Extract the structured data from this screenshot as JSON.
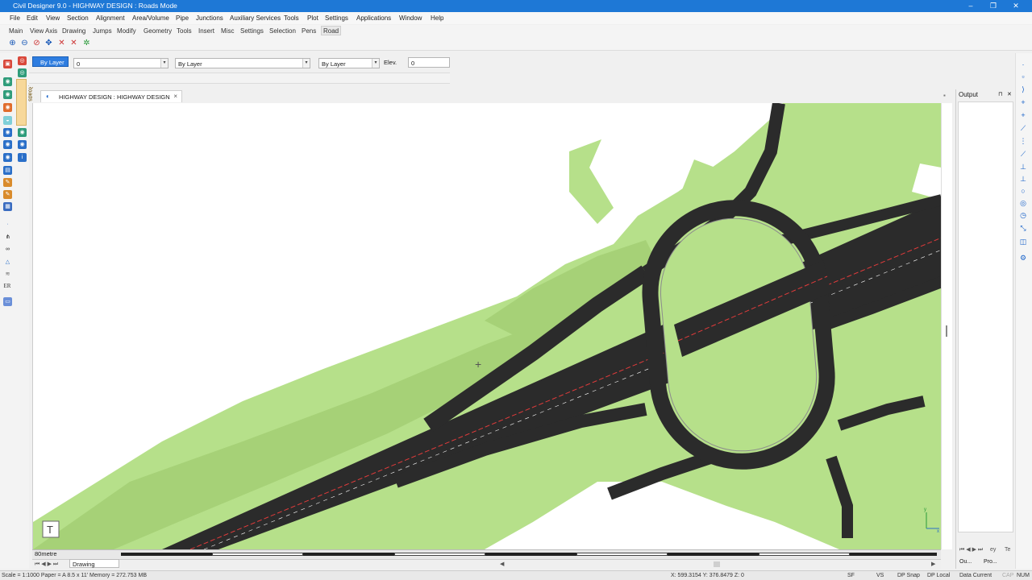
{
  "window": {
    "title": "Civil Designer 9.0 - HIGHWAY DESIGN : Roads Mode",
    "controls": [
      "–",
      "❐",
      "✕"
    ]
  },
  "menu": [
    "File",
    "Edit",
    "View",
    "Section",
    "Alignment",
    "Area/Volume",
    "Pipe",
    "Junctions",
    "Auxiliary Services",
    "Tools",
    "Plot",
    "Settings",
    "Applications",
    "Window",
    "Help"
  ],
  "ribbon_tabs": [
    "Main",
    "View Axis",
    "Drawing",
    "Jumps",
    "Modify",
    "Geometry",
    "Tools",
    "Insert",
    "Misc",
    "Settings",
    "Selection",
    "Pens",
    "Road"
  ],
  "ribbon_active_tab": "Road",
  "properties": {
    "color_button": "By Layer",
    "layer_value": "0",
    "linetype_value": "By Layer",
    "lineweight_value": "By Layer",
    "elev_label": "Elev.",
    "elev_value": "0"
  },
  "left_panel": {
    "roads_label": "Roads",
    "er_label": "ER"
  },
  "document_tab": {
    "title": "HIGHWAY DESIGN : HIGHWAY DESIGN",
    "close": "×"
  },
  "output_panel": {
    "title": "Output",
    "pin": "⊓",
    "close": "✕",
    "tab1": "Ou...",
    "tab2": "Pro...",
    "tab3": "ey",
    "tab4": "Te"
  },
  "canvas": {
    "cursor": "+",
    "axis_x": "x",
    "axis_y": "y",
    "colors": {
      "terrain": "#b6e08a",
      "terrain_dark": "#a6d177",
      "road": "#2b2b2b",
      "kerb": "#8c8c8c",
      "markings": "#e23b3b",
      "background": "#ffffff"
    }
  },
  "scale_ruler": {
    "label": "80metre"
  },
  "layout_tab": {
    "label": "Drawing"
  },
  "status": {
    "left": "Scale = 1:1000  Paper = A 8.5 x 11'  Memory = 272.753 MB",
    "coords": "X: 599.3154 Y: 376.8479 Z: 0",
    "sf": "SF",
    "vs": "VS",
    "dp_snap": "DP Snap",
    "dp_local": "DP Local",
    "data_current": "Data Current",
    "cap": "CAP",
    "num": "NUM"
  }
}
